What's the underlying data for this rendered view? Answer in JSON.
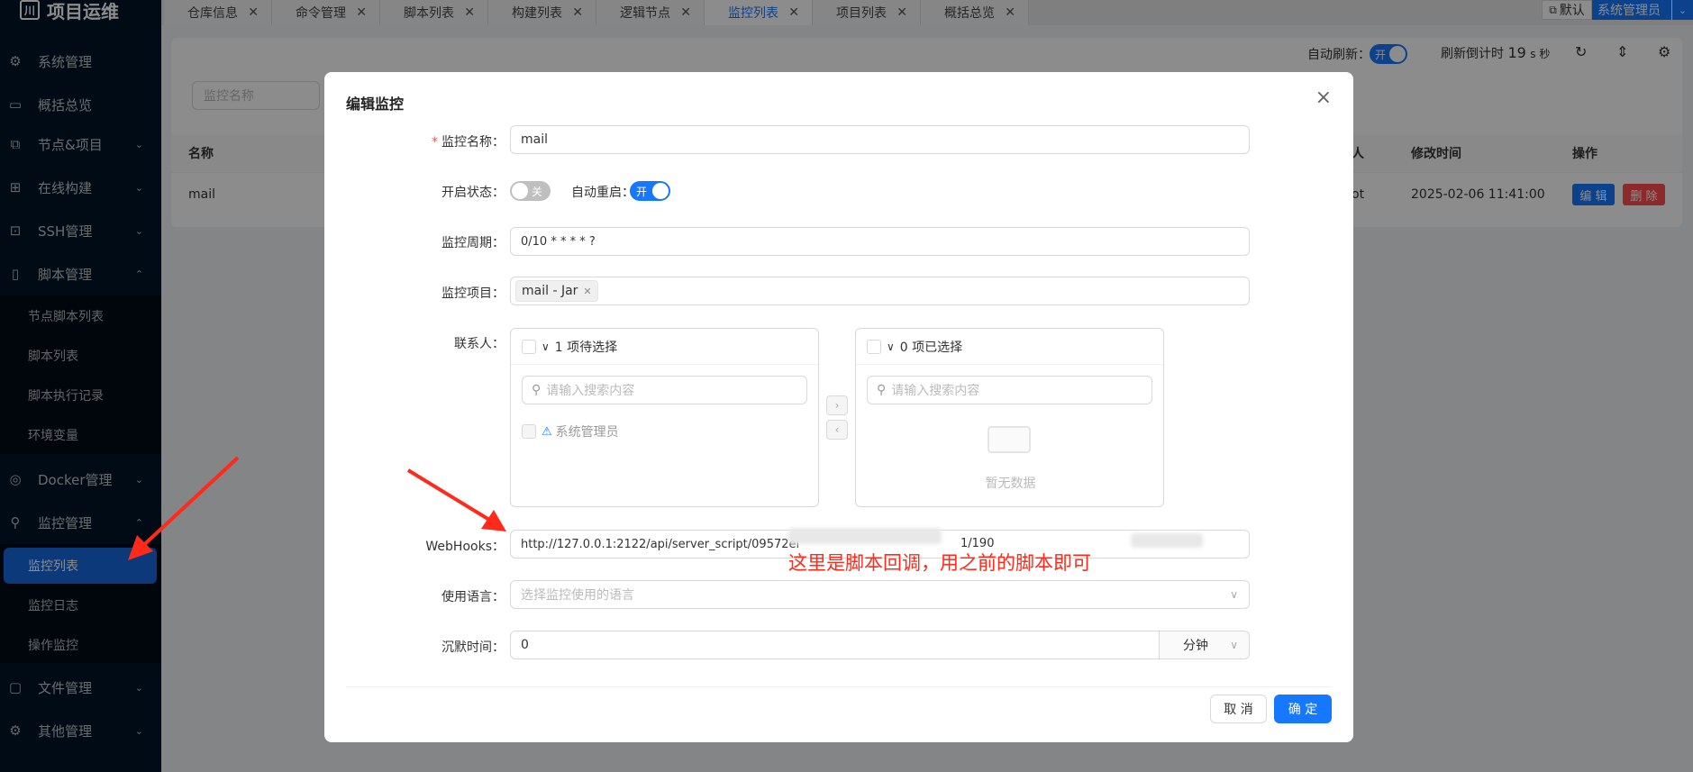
{
  "app": {
    "title": "项目运维"
  },
  "sidebar": {
    "items": [
      {
        "label": "系统管理",
        "icon": "gear-icon"
      },
      {
        "label": "概括总览",
        "icon": "laptop-icon"
      },
      {
        "label": "节点&项目",
        "icon": "cluster-icon"
      },
      {
        "label": "在线构建",
        "icon": "build-icon"
      },
      {
        "label": "SSH管理",
        "icon": "terminal-icon"
      },
      {
        "label": "脚本管理",
        "icon": "file-icon"
      },
      {
        "label": "Docker管理",
        "icon": "docker-icon"
      },
      {
        "label": "监控管理",
        "icon": "monitor-icon"
      },
      {
        "label": "文件管理",
        "icon": "folder-icon"
      },
      {
        "label": "其他管理",
        "icon": "settings-icon"
      }
    ],
    "script_sub": [
      "节点脚本列表",
      "脚本列表",
      "脚本执行记录",
      "环境变量"
    ],
    "monitor_sub": [
      "监控列表",
      "监控日志",
      "操作监控"
    ]
  },
  "tabs": [
    "仓库信息",
    "命令管理",
    "脚本列表",
    "构建列表",
    "逻辑节点",
    "监控列表",
    "项目列表",
    "概括总览"
  ],
  "topbar": {
    "default_label": "默认",
    "user_label": "系统管理员"
  },
  "toolbar": {
    "auto_refresh_label": "自动刷新：",
    "auto_refresh_state": "开",
    "countdown_prefix": "刷新倒计时",
    "countdown_value": "19",
    "countdown_unit": "s 秒"
  },
  "list": {
    "search_placeholder": "监控名称",
    "headers": [
      "名称",
      "人",
      "修改时间",
      "操作"
    ],
    "row": {
      "name": "mail",
      "user_tail": "ot",
      "modified": "2025-02-06 11:41:00",
      "edit": "编 辑",
      "delete": "删 除"
    }
  },
  "modal": {
    "title": "编辑监控",
    "fields": {
      "name_label": "监控名称",
      "name_value": "mail",
      "status_label": "开启状态",
      "status_state": "关",
      "auto_restart_label": "自动重启",
      "auto_restart_state": "开",
      "cycle_label": "监控周期",
      "cycle_value": "0/10 * * * * ?",
      "project_label": "监控项目",
      "project_tag": "mail - Jar",
      "contact_label": "联系人",
      "transfer_left_title": "1 项待选择",
      "transfer_right_title": "0 项已选择",
      "transfer_search_placeholder": "请输入搜索内容",
      "transfer_left_item": "系统管理员",
      "transfer_empty": "暂无数据",
      "webhooks_label": "WebHooks",
      "webhooks_value": "http://127.0.0.1:2122/api/server_script/09572el",
      "webhooks_tail": "1/190",
      "language_label": "使用语言",
      "language_placeholder": "选择监控使用的语言",
      "silence_label": "沉默时间",
      "silence_value": "0",
      "silence_unit": "分钟"
    },
    "cancel": "取 消",
    "ok": "确 定"
  },
  "annotation": {
    "text": "这里是脚本回调，用之前的脚本即可",
    "color": "#ff2a1a"
  },
  "colors": {
    "primary": "#1677ff",
    "sidebar_bg": "#001529",
    "danger": "#ff4d4f"
  }
}
